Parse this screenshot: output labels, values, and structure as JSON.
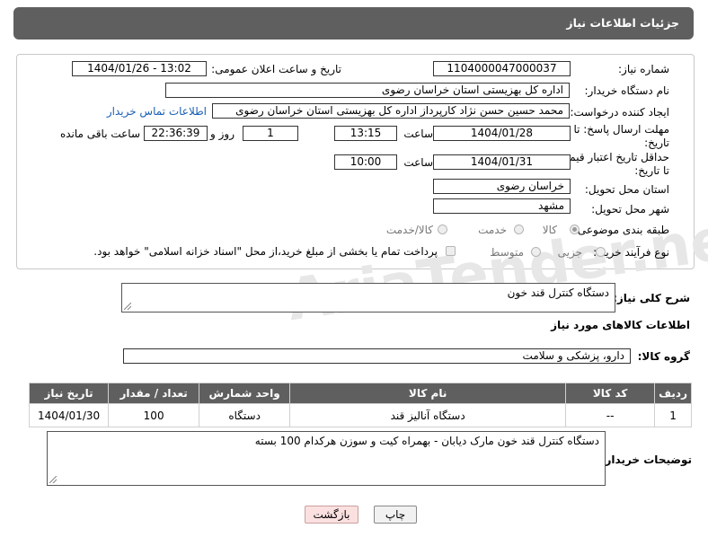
{
  "header": {
    "title": "جزئیات اطلاعات نیاز"
  },
  "watermark": "AriaTender.net",
  "fields": {
    "need_number_label": "شماره نیاز:",
    "need_number": "1104000047000037",
    "announce_label": "تاریخ و ساعت اعلان عمومی:",
    "announce_value": "1404/01/26 - 13:02",
    "buyer_org_label": "نام دستگاه خریدار:",
    "buyer_org": "اداره کل بهزیستی استان خراسان رضوی",
    "requester_label": "ایجاد کننده درخواست:",
    "requester": "محمد حسین حسن نژاد کارپرداز اداره کل بهزیستی استان خراسان رضوی",
    "contact_link": "اطلاعات تماس خریدار",
    "deadline_label_1": "مهلت ارسال پاسخ: تا",
    "deadline_label_2": "تاریخ:",
    "deadline_date": "1404/01/28",
    "time_label": "ساعت",
    "deadline_time": "13:15",
    "days_value": "1",
    "days_label": "روز و",
    "remaining_time": "22:36:39",
    "remaining_label": "ساعت باقی مانده",
    "validity_label_1": "حداقل تاریخ اعتبار قیمت:",
    "validity_label_2": "تا تاریخ:",
    "validity_date": "1404/01/31",
    "validity_time_label": "ساعت",
    "validity_time": "10:00",
    "province_label": "استان محل تحویل:",
    "province": "خراسان رضوی",
    "city_label": "شهر محل تحویل:",
    "city": "مشهد",
    "category_label": "طبقه بندی موضوعی:",
    "category_options": [
      "کالا",
      "خدمت",
      "کالا/خدمت"
    ],
    "category_selected": "کالا",
    "process_label": "نوع فرآیند خرید :",
    "process_options": [
      "جزیی",
      "متوسط"
    ],
    "payment_note": "پرداخت تمام یا بخشی از مبلغ خرید،از محل \"اسناد خزانه اسلامی\" خواهد بود."
  },
  "summary": {
    "label": "شرح کلی نیاز:",
    "value": "دستگاه کنترل قند خون"
  },
  "goods_section_title": "اطلاعات کالاهای مورد نیاز",
  "goods_group": {
    "label": "گروه کالا:",
    "value": "دارو، پزشکی و سلامت"
  },
  "table": {
    "headers": [
      "ردیف",
      "کد کالا",
      "نام کالا",
      "واحد شمارش",
      "تعداد / مقدار",
      "تاریخ نیاز"
    ],
    "rows": [
      [
        "1",
        "--",
        "دستگاه آنالیز قند",
        "دستگاه",
        "100",
        "1404/01/30"
      ]
    ]
  },
  "buyer_notes": {
    "label": "توضیحات خریدار:",
    "value": "دستگاه کنترل قند خون مارک دیابان  - بهمراه کیت و سوزن هرکدام 100 بسته"
  },
  "buttons": {
    "print": "چاپ",
    "back": "بازگشت"
  }
}
